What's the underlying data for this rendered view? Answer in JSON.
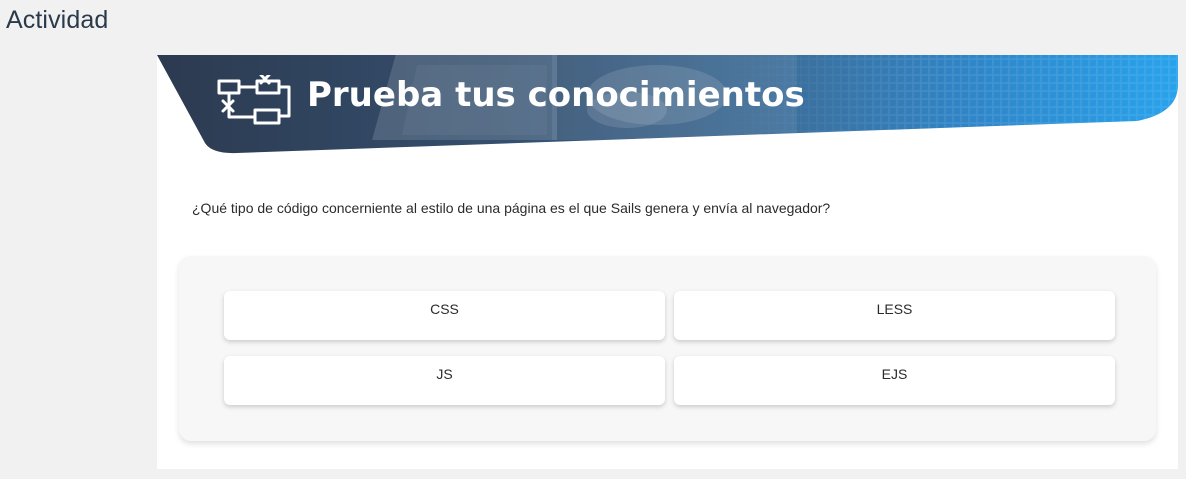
{
  "page": {
    "heading": "Actividad"
  },
  "banner": {
    "title": "Prueba tus conocimientos",
    "icon": "flowchart-icon",
    "colors": {
      "dark": "#2f3e55",
      "mid": "#3b6e9a",
      "light": "#2f9be0"
    }
  },
  "quiz": {
    "question": "¿Qué tipo de código concerniente al estilo de una página es el que Sails genera y envía al navegador?",
    "options": [
      {
        "label": "CSS"
      },
      {
        "label": "LESS"
      },
      {
        "label": "JS"
      },
      {
        "label": "EJS"
      }
    ]
  }
}
